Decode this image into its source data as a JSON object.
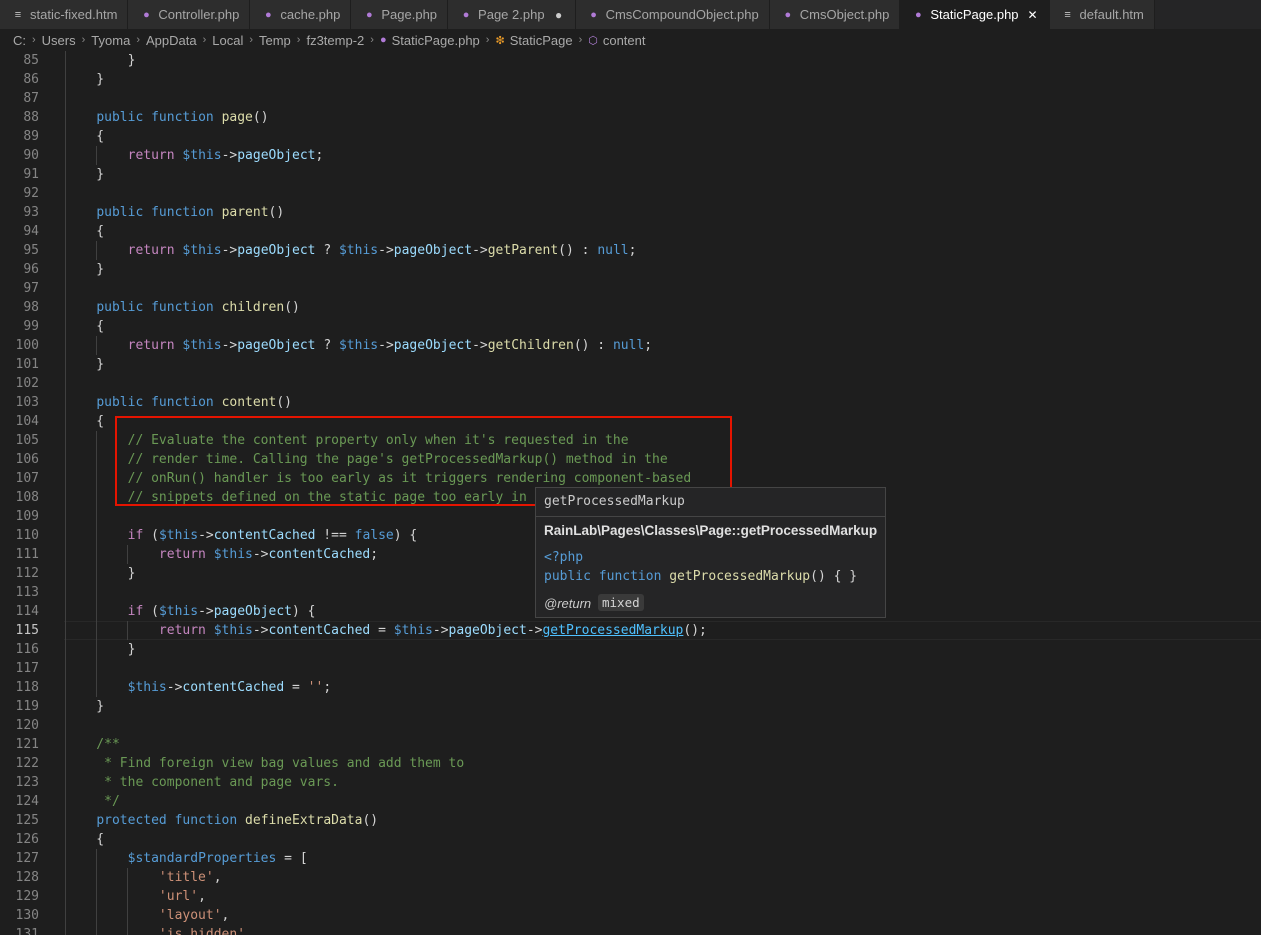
{
  "tabs": [
    {
      "icon": "file-lines-icon",
      "label": "static-fixed.htm",
      "active": false,
      "right": ""
    },
    {
      "icon": "php-elephant-icon",
      "label": "Controller.php",
      "active": false,
      "right": ""
    },
    {
      "icon": "php-elephant-icon",
      "label": "cache.php",
      "active": false,
      "right": ""
    },
    {
      "icon": "php-elephant-icon",
      "label": "Page.php",
      "active": false,
      "right": ""
    },
    {
      "icon": "php-elephant-icon",
      "label": "Page 2.php",
      "active": false,
      "right": "dot"
    },
    {
      "icon": "php-elephant-icon",
      "label": "CmsCompoundObject.php",
      "active": false,
      "right": ""
    },
    {
      "icon": "php-elephant-icon",
      "label": "CmsObject.php",
      "active": false,
      "right": ""
    },
    {
      "icon": "php-elephant-icon",
      "label": "StaticPage.php",
      "active": true,
      "right": "close"
    },
    {
      "icon": "file-lines-icon",
      "label": "default.htm",
      "active": false,
      "right": ""
    }
  ],
  "breadcrumb": {
    "segments": [
      "C:",
      "Users",
      "Tyoma",
      "AppData",
      "Local",
      "Temp",
      "fz3temp-2"
    ],
    "file": "StaticPage.php",
    "class": "StaticPage",
    "method": "content"
  },
  "editor": {
    "current_line": 115,
    "lines": [
      {
        "n": 85,
        "t": "        }"
      },
      {
        "n": 86,
        "t": "    }"
      },
      {
        "n": 87,
        "t": ""
      },
      {
        "n": 88,
        "t": "    public function page()"
      },
      {
        "n": 89,
        "t": "    {"
      },
      {
        "n": 90,
        "t": "        return $this->pageObject;"
      },
      {
        "n": 91,
        "t": "    }"
      },
      {
        "n": 92,
        "t": ""
      },
      {
        "n": 93,
        "t": "    public function parent()"
      },
      {
        "n": 94,
        "t": "    {"
      },
      {
        "n": 95,
        "t": "        return $this->pageObject ? $this->pageObject->getParent() : null;"
      },
      {
        "n": 96,
        "t": "    }"
      },
      {
        "n": 97,
        "t": ""
      },
      {
        "n": 98,
        "t": "    public function children()"
      },
      {
        "n": 99,
        "t": "    {"
      },
      {
        "n": 100,
        "t": "        return $this->pageObject ? $this->pageObject->getChildren() : null;"
      },
      {
        "n": 101,
        "t": "    }"
      },
      {
        "n": 102,
        "t": ""
      },
      {
        "n": 103,
        "t": "    public function content()"
      },
      {
        "n": 104,
        "t": "    {"
      },
      {
        "n": 105,
        "t": "        // Evaluate the content property only when it's requested in the"
      },
      {
        "n": 106,
        "t": "        // render time. Calling the page's getProcessedMarkup() method in the"
      },
      {
        "n": 107,
        "t": "        // onRun() handler is too early as it triggers rendering component-based"
      },
      {
        "n": 108,
        "t": "        // snippets defined on the static page too early in t"
      },
      {
        "n": 109,
        "t": ""
      },
      {
        "n": 110,
        "t": "        if ($this->contentCached !== false) {"
      },
      {
        "n": 111,
        "t": "            return $this->contentCached;"
      },
      {
        "n": 112,
        "t": "        }"
      },
      {
        "n": 113,
        "t": ""
      },
      {
        "n": 114,
        "t": "        if ($this->pageObject) {"
      },
      {
        "n": 115,
        "t": "            return $this->contentCached = $this->pageObject->getProcessedMarkup();"
      },
      {
        "n": 116,
        "t": "        }"
      },
      {
        "n": 117,
        "t": ""
      },
      {
        "n": 118,
        "t": "        $this->contentCached = '';"
      },
      {
        "n": 119,
        "t": "    }"
      },
      {
        "n": 120,
        "t": ""
      },
      {
        "n": 121,
        "t": "    /**"
      },
      {
        "n": 122,
        "t": "     * Find foreign view bag values and add them to"
      },
      {
        "n": 123,
        "t": "     * the component and page vars."
      },
      {
        "n": 124,
        "t": "     */"
      },
      {
        "n": 125,
        "t": "    protected function defineExtraData()"
      },
      {
        "n": 126,
        "t": "    {"
      },
      {
        "n": 127,
        "t": "        $standardProperties = ["
      },
      {
        "n": 128,
        "t": "            'title',"
      },
      {
        "n": 129,
        "t": "            'url',"
      },
      {
        "n": 130,
        "t": "            'layout',"
      },
      {
        "n": 131,
        "t": "            'is_hidden',"
      }
    ]
  },
  "hover": {
    "name": "getProcessedMarkup",
    "signature": "RainLab\\Pages\\Classes\\Page::getProcessedMarkup",
    "php_tag": "<?php",
    "decl_keywords": "public function ",
    "decl_name": "getProcessedMarkup",
    "decl_rest": "() { }",
    "return_tag": "@return",
    "return_type": "mixed"
  },
  "colors": {
    "background": "#1e1e1e",
    "keyword": "#569cd6",
    "control": "#c586c0",
    "function": "#dcdcaa",
    "property": "#9cdcfe",
    "comment": "#6a9955",
    "string": "#ce9178",
    "highlight_box": "#e51400"
  }
}
